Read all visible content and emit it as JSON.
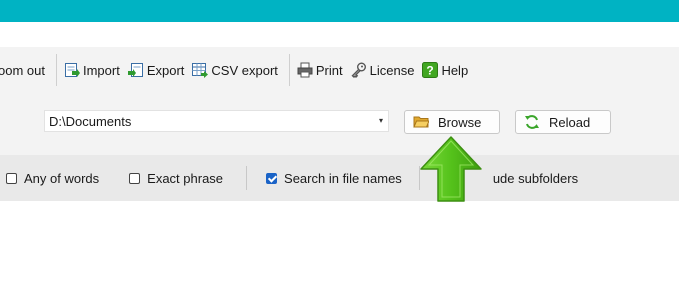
{
  "toolbar": {
    "zoom_out_label": "oom out",
    "import_label": "Import",
    "export_label": "Export",
    "csv_export_label": "CSV export",
    "print_label": "Print",
    "license_label": "License",
    "help_label": "Help"
  },
  "path": {
    "value": "D:\\Documents",
    "dropdown_glyph": "▾"
  },
  "buttons": {
    "browse_label": "Browse",
    "reload_label": "Reload"
  },
  "options": {
    "any_of_words": {
      "label": "Any of words",
      "checked": false
    },
    "exact_phrase": {
      "label": "Exact phrase",
      "checked": false
    },
    "search_in_file_names": {
      "label": "Search in file names",
      "checked": true
    },
    "include_subfolders": {
      "label": "ude subfolders",
      "checked": true
    }
  },
  "colors": {
    "titlebar": "#00b3c3",
    "checkbox_checked": "#1a63c7",
    "arrow": "#55c21b"
  },
  "icons": {
    "import": "import-icon",
    "export": "export-icon",
    "csv": "csv-export-icon",
    "print": "printer-icon",
    "license": "key-icon",
    "help": "help-icon",
    "browse": "folder-icon",
    "reload": "reload-icon",
    "callout": "up-arrow-icon"
  }
}
